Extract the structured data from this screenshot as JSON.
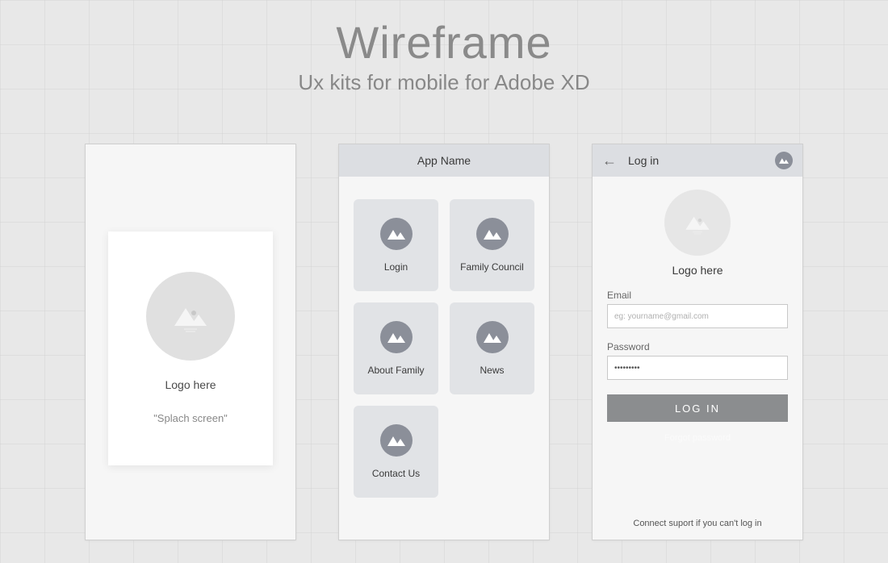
{
  "header": {
    "title": "Wireframe",
    "subtitle": "Ux kits for mobile for Adobe XD"
  },
  "splash": {
    "logo_label": "Logo here",
    "caption": "\"Splach screen\""
  },
  "menu": {
    "app_name": "App Name",
    "tiles": [
      {
        "label": "Login"
      },
      {
        "label": "Family Council"
      },
      {
        "label": "About Family"
      },
      {
        "label": "News"
      },
      {
        "label": "Contact Us"
      }
    ]
  },
  "login": {
    "title": "Log in",
    "logo_label": "Logo here",
    "email_label": "Email",
    "email_placeholder": "eg: yourname@gmail.com",
    "password_label": "Password",
    "password_value": "•••••••••",
    "button": "LOG IN",
    "forgot": "Forgot password",
    "support": "Connect suport if you can't log in"
  }
}
